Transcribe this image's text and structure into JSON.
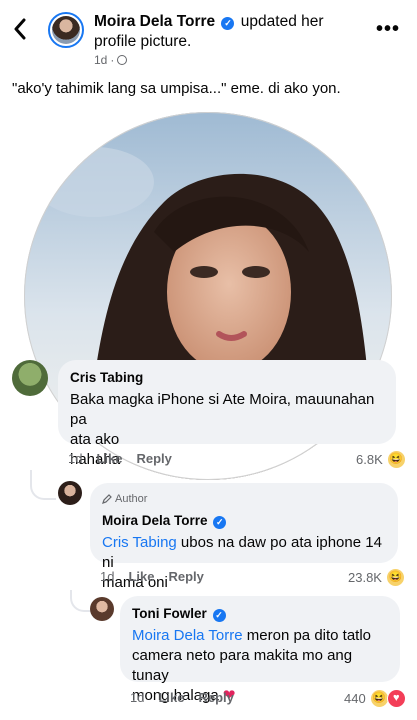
{
  "header": {
    "name": "Moira Dela Torre",
    "action_text": "updated her profile picture.",
    "time": "1d",
    "separator": "·",
    "more_label": "•••"
  },
  "post": {
    "caption": "\"ako'y tahimik lang sa umpisa...\" eme. di ako yon."
  },
  "comments": [
    {
      "author": "Cris Tabing",
      "text_line1": "Baka magka iPhone si Ate Moira, mauunahan pa",
      "text_line2": "ata ako",
      "text_line3": "hahaha",
      "time": "1d",
      "like_label": "Like",
      "reply_label": "Reply",
      "reaction_count": "6.8K"
    },
    {
      "badge": "Author",
      "author": "Moira Dela Torre",
      "tag": "Cris Tabing",
      "text_after_tag": " ubos na daw po ata iphone 14 ni",
      "text_line2": "mama oni",
      "time": "1d",
      "like_label": "Like",
      "reply_label": "Reply",
      "reaction_count": "23.8K"
    },
    {
      "author": "Toni Fowler",
      "tag": "Moira Dela Torre",
      "text_after_tag": " meron pa dito tatlo",
      "text_line2": "camera neto para makita mo ang tunay",
      "text_line3": "mong halaga",
      "time": "1d",
      "like_label": "Like",
      "reply_label": "Reply",
      "reaction_count": "440"
    }
  ],
  "colors": {
    "accent": "#1877f2",
    "bubble": "#f0f2f5",
    "muted": "#65676b"
  }
}
